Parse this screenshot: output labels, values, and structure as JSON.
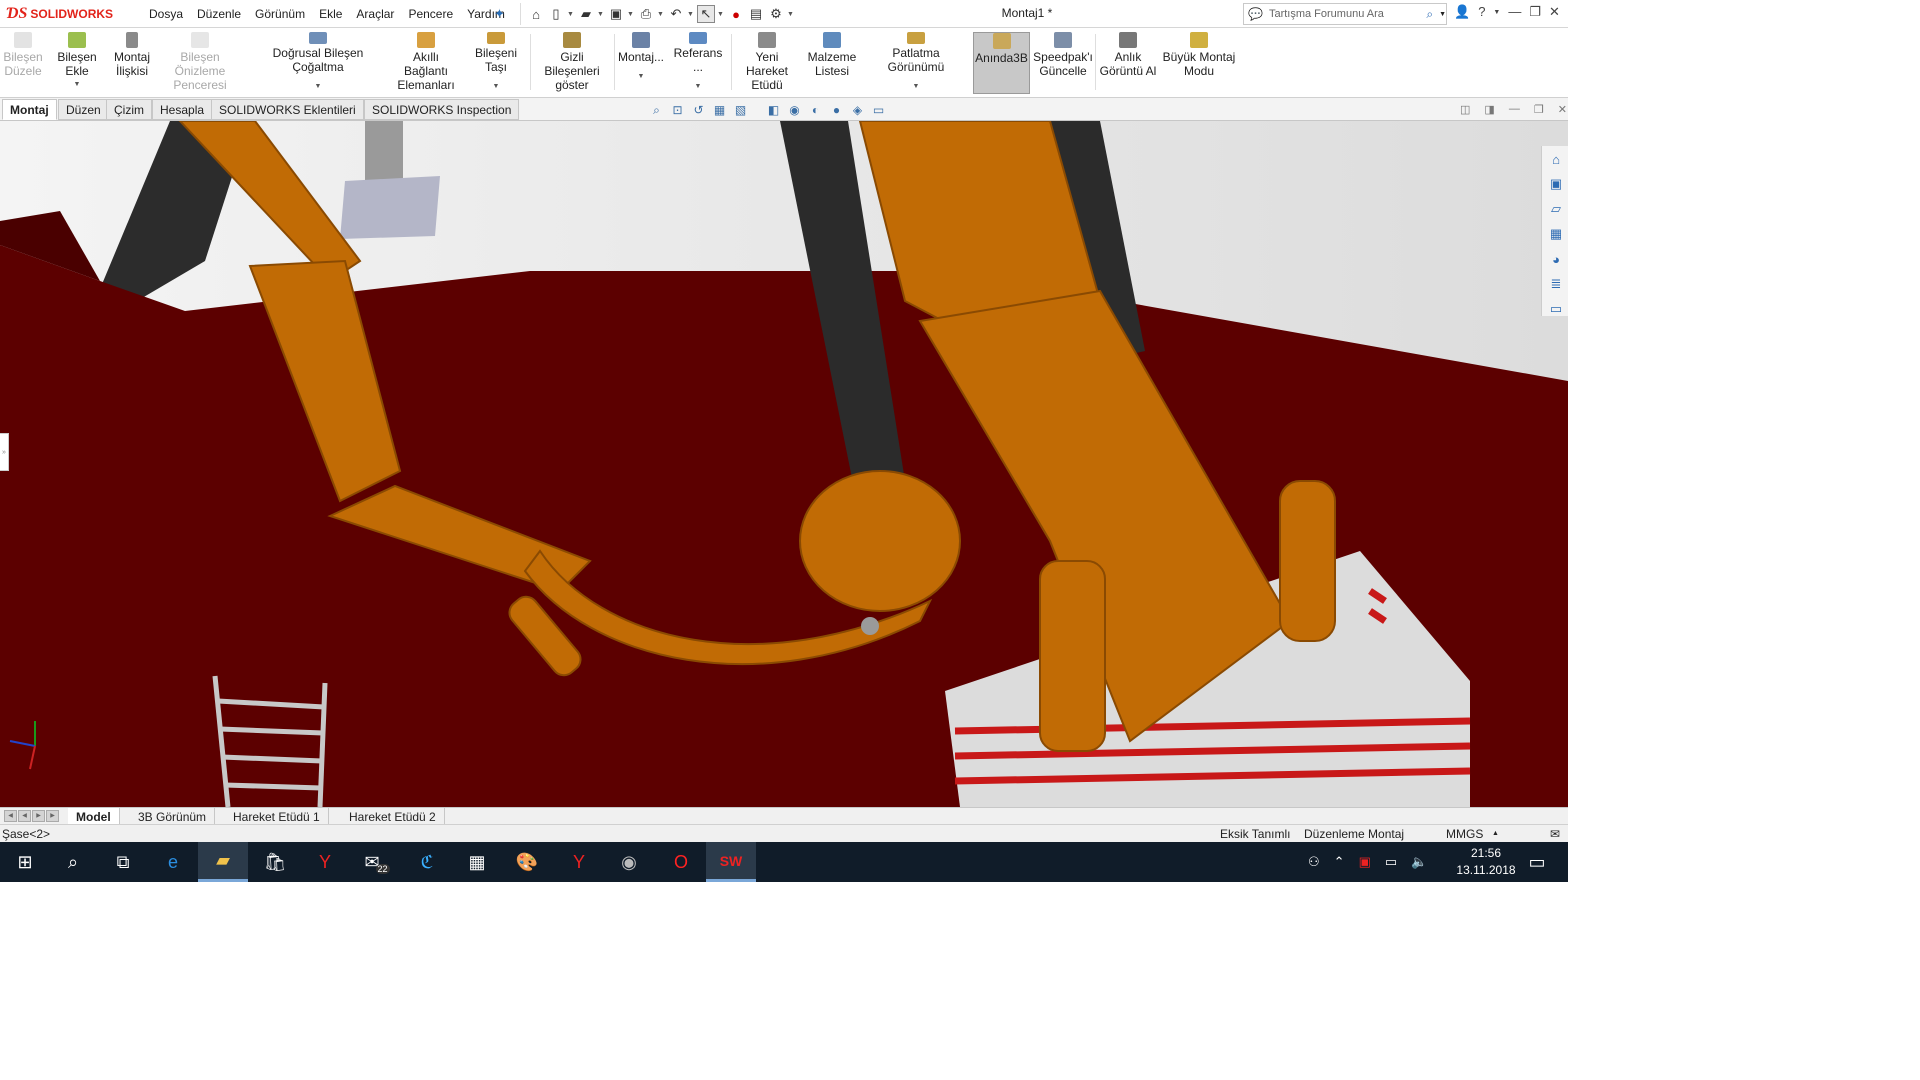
{
  "app": {
    "brand": "SOLIDWORKS",
    "document_title": "Montaj1 *"
  },
  "menu": [
    "Dosya",
    "Düzenle",
    "Görünüm",
    "Ekle",
    "Araçlar",
    "Pencere",
    "Yardım"
  ],
  "search": {
    "placeholder": "Tartışma Forumunu Ara"
  },
  "toolbar": {
    "bilesen_duzele": "Bileşen Düzele",
    "bilesen_ekle": "Bileşen Ekle",
    "montaj_iliskisi": "Montaj İlişkisi",
    "bilesen_onizleme": "Bileşen Önizleme Penceresi",
    "dogrusal_cogaltma": "Doğrusal Bileşen Çoğaltma",
    "akilli_baglanti": "Akıllı Bağlantı Elemanları",
    "bileseni_tasi": "Bileşeni Taşı",
    "gizli_bilesenler": "Gizli Bileşenleri göster",
    "montaj_dd": "Montaj...",
    "referans_dd": "Referans ...",
    "yeni_hareket": "Yeni Hareket Etüdü",
    "malzeme_listesi": "Malzeme Listesi",
    "patlatma": "Patlatma Görünümü",
    "aninda3b": "Anında3B",
    "speedpak": "Speedpak'ı Güncelle",
    "anlik_goruntu": "Anlık Görüntü Al",
    "buyuk_montaj": "Büyük Montaj Modu"
  },
  "tabs": [
    "Montaj",
    "Düzen",
    "Çizim",
    "Hesapla",
    "SOLIDWORKS Eklentileri",
    "SOLIDWORKS Inspection"
  ],
  "bottom_tabs": [
    "Model",
    "3B Görünüm",
    "Hareket Etüdü 1",
    "Hareket Etüdü 2"
  ],
  "status": {
    "selection": "Şase<2>",
    "definition": "Eksik Tanımlı",
    "mode": "Düzenleme Montaj",
    "units": "MMGS"
  },
  "taskbar": {
    "time": "21:56",
    "date": "13.11.2018",
    "mail_badge": "22"
  },
  "colors": {
    "orange": "#c16b05",
    "maroon": "#5c0000",
    "dark": "#2a2a2a",
    "steel": "#c8c8c8"
  }
}
